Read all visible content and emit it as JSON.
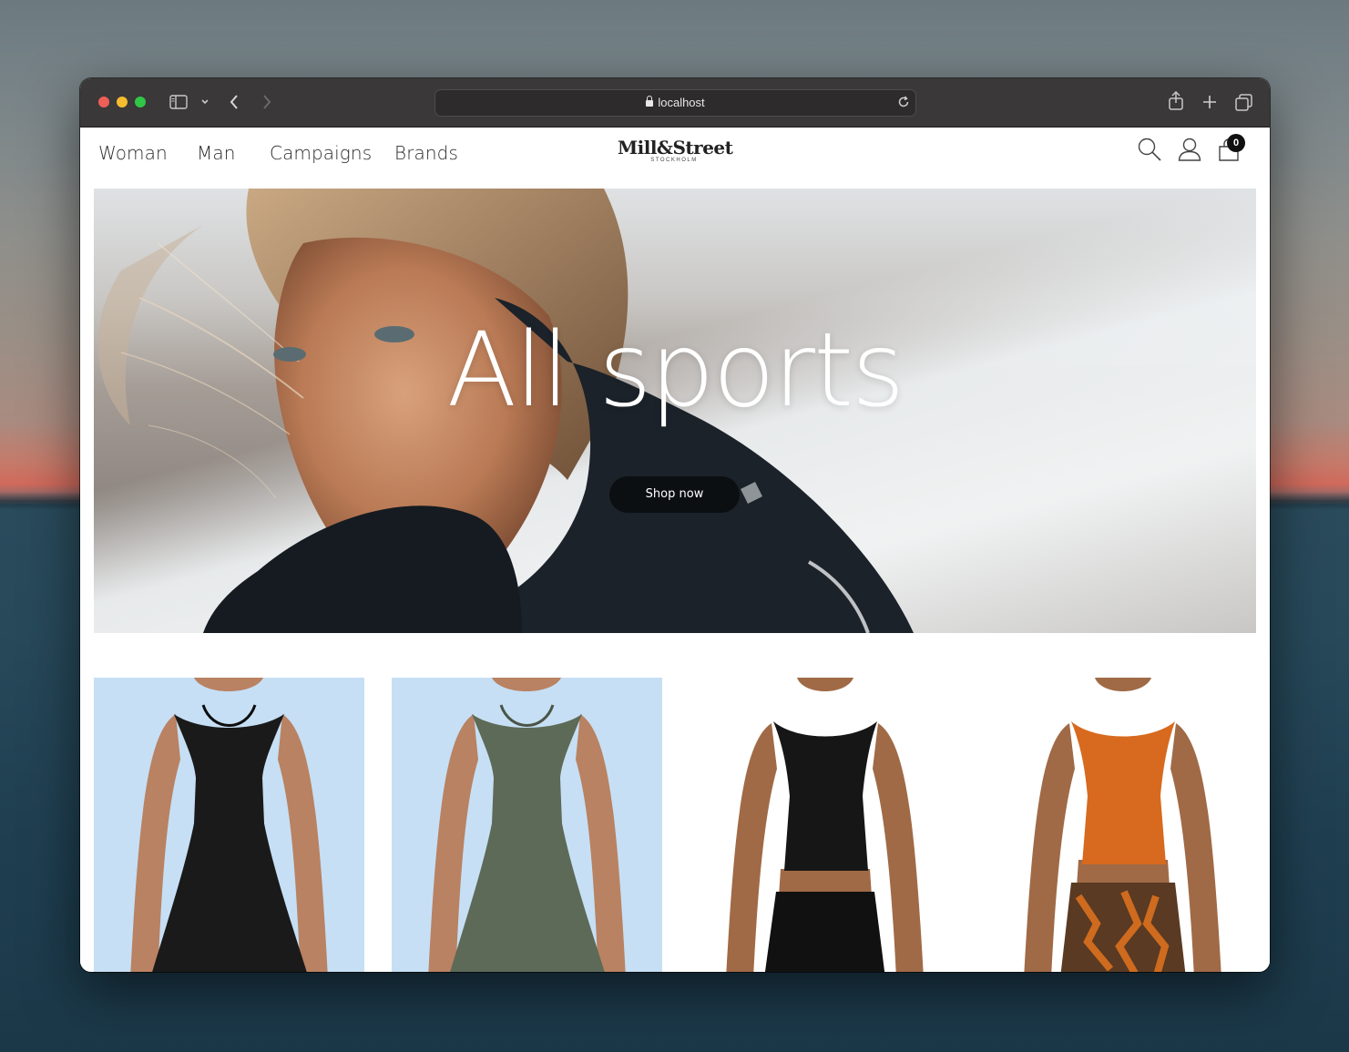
{
  "browser": {
    "url": "localhost",
    "badge_count": "0"
  },
  "nav": {
    "items": [
      {
        "label": "Woman"
      },
      {
        "label": "Man"
      },
      {
        "label": "Campaigns"
      },
      {
        "label": "Brands"
      }
    ]
  },
  "logo": {
    "name": "Mill&Street",
    "tagline": "STOCKHOLM"
  },
  "hero": {
    "title": "All sports",
    "button_label": "Shop now"
  },
  "products": [
    {
      "name": "black-dress",
      "background": "#c6dff5",
      "color": "#1a1a1a"
    },
    {
      "name": "olive-dress",
      "background": "#c6dff5",
      "color": "#5d6a57"
    },
    {
      "name": "black-crop-top",
      "background": "#ffffff",
      "color": "#161616"
    },
    {
      "name": "orange-crop-top",
      "background": "#ffffff",
      "color": "#d76a1e"
    }
  ],
  "colors": {
    "accent": "#0c0f12",
    "product_bg": "#c6dff5"
  }
}
